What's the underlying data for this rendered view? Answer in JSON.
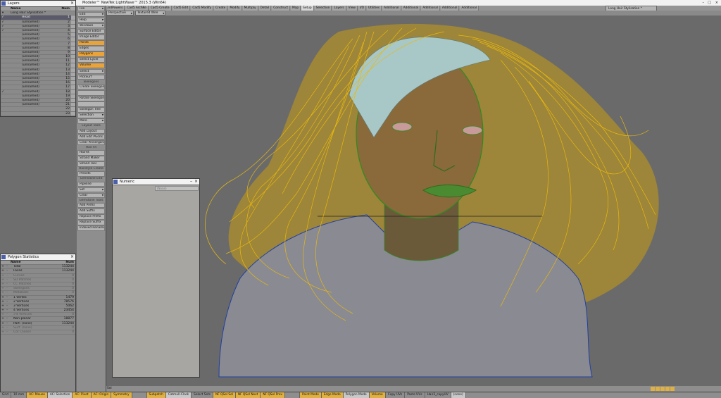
{
  "window_title": "Modeler™ NewTek LightWave™ 2015.3 (Win64)",
  "menu_button": "File",
  "tabs": [
    "3rdPowers",
    "Cad5 ArchKe",
    "Cad5 Create",
    "Cad5 Edit",
    "Cad5 Modify",
    "Create",
    "Modify",
    "Multiply",
    "Detail",
    "Construct",
    "Map",
    "Setup",
    "Selection",
    "Layers",
    "View",
    "I/O",
    "Utilities",
    "Additional",
    "Additional",
    "Additional",
    "Additional",
    "Additional"
  ],
  "active_tab": "Setup",
  "scene_label": "Long Hair Stylisation *",
  "viewport": {
    "projection": "Perspective",
    "render_mode": "Textured Wire"
  },
  "toolbox": [
    {
      "label": "File",
      "dd": true
    },
    {
      "label": "Edit",
      "dd": true
    },
    {
      "label": "Help",
      "dd": true
    },
    {
      "label": "Windows",
      "dd": true
    },
    {
      "label": "Surface Editor"
    },
    {
      "label": "Image Editor"
    },
    {
      "label": "Points",
      "on": true
    },
    {
      "label": "Edges"
    },
    {
      "label": "Polygons",
      "on": true
    },
    {
      "label": "Select Cycle"
    },
    {
      "label": "Volume",
      "on": true
    },
    {
      "label": "Select",
      "dd": true
    },
    {
      "label": "PickSurf"
    },
    {
      "head": "Skelegons"
    },
    {
      "label": "Create Skelegons"
    },
    {
      "label": ""
    },
    {
      "label": "Rotate Skelegons"
    },
    {
      "label": ""
    },
    {
      "label": "Skelegon Tree"
    },
    {
      "label": "Selection",
      "dd": true
    },
    {
      "label": "More",
      "dd": true
    },
    {
      "head": "Layout Tools"
    },
    {
      "label": "Add Layout"
    },
    {
      "label": "Add Edit PGons"
    },
    {
      "label": "Clear Pinnergons"
    },
    {
      "head": "Hair Fit"
    },
    {
      "label": "HairFit"
    },
    {
      "label": "Strand Maker"
    },
    {
      "label": "Strand Tool"
    },
    {
      "head": "Hairstyle Create"
    },
    {
      "label": "Presets"
    },
    {
      "head": "Gemstone Edit"
    },
    {
      "label": "Pipeline"
    },
    {
      "label": "Set",
      "dd": true
    },
    {
      "label": "Clear",
      "dd": true
    },
    {
      "head": "Gemstone Tools"
    },
    {
      "label": "Add Prefix"
    },
    {
      "label": "Add Suffix"
    },
    {
      "label": "Replace Prefix"
    },
    {
      "label": "Replace Suffix"
    },
    {
      "label": "Indexed Rename"
    }
  ],
  "layers_panel": {
    "title": "Layers",
    "header": {
      "name": "Name",
      "num": "Num"
    },
    "root": "Long Hair Stylisation *",
    "rows": [
      {
        "name": "Head",
        "num": "1",
        "sel": true
      },
      {
        "name": "(unnamed)",
        "num": "2"
      },
      {
        "name": "(unnamed)",
        "num": "3"
      },
      {
        "name": "(unnamed)",
        "num": "4"
      },
      {
        "name": "(unnamed)",
        "num": "5"
      },
      {
        "name": "(unnamed)",
        "num": "6"
      },
      {
        "name": "(unnamed)",
        "num": "7"
      },
      {
        "name": "(unnamed)",
        "num": "8"
      },
      {
        "name": "(unnamed)",
        "num": "9"
      },
      {
        "name": "(unnamed)",
        "num": "10"
      },
      {
        "name": "(unnamed)",
        "num": "11"
      },
      {
        "name": "(unnamed)",
        "num": "12"
      },
      {
        "name": "(unnamed)",
        "num": "13"
      },
      {
        "name": "(unnamed)",
        "num": "14"
      },
      {
        "name": "(unnamed)",
        "num": "15"
      },
      {
        "name": "(unnamed)",
        "num": "16"
      },
      {
        "name": "(unnamed)",
        "num": "17"
      },
      {
        "name": "(unnamed)",
        "num": "18"
      },
      {
        "name": "(unnamed)",
        "num": "19"
      },
      {
        "name": "(unnamed)",
        "num": "20"
      },
      {
        "name": "(unnamed)",
        "num": "21"
      },
      {
        "name": "",
        "num": "22"
      },
      {
        "name": "",
        "num": "23"
      }
    ]
  },
  "polygon_statistics": {
    "title": "Polygon Statistics",
    "header": {
      "name": "Name",
      "num": "Num"
    },
    "rows": [
      {
        "name": "Total",
        "num": "113244"
      },
      {
        "name": "Faces",
        "num": "113244"
      },
      {
        "name": "Curves",
        "num": "0",
        "dim": true
      },
      {
        "name": "SD Patches",
        "num": "0",
        "dim": true
      },
      {
        "name": "CC Patches",
        "num": "0",
        "dim": true
      },
      {
        "name": "Skelegons",
        "num": "0",
        "dim": true
      },
      {
        "name": "Metaballs",
        "num": "0",
        "dim": true
      },
      {
        "name": "1 Vertex",
        "num": "1479"
      },
      {
        "name": "2 Vertices",
        "num": "78576"
      },
      {
        "name": "3 Vertices",
        "num": "5062"
      },
      {
        "name": "4 Vertices",
        "num": "23454"
      },
      {
        "name": ">4 Vertices",
        "num": "0",
        "dim": true
      },
      {
        "name": "Non-planar",
        "num": "18877"
      },
      {
        "name": "Part: (none)",
        "num": "113244"
      },
      {
        "name": "Surf: (none)",
        "num": "0",
        "dim": true
      },
      {
        "name": "Col: (none)",
        "num": "0",
        "dim": true
      }
    ]
  },
  "numeric_panel": {
    "title": "Numeric",
    "field": "(None)"
  },
  "bottom_field": "Sel",
  "status": [
    {
      "t": "Grid",
      "c": ""
    },
    {
      "t": "10 mm",
      "c": ""
    },
    {
      "t": "AC: Mouse",
      "c": "hl"
    },
    {
      "t": "AC: Selection",
      "c": "lt"
    },
    {
      "t": "AC: Pivot",
      "c": "hl"
    },
    {
      "t": "AC: Origin",
      "c": "hl"
    },
    {
      "t": "Symmetry",
      "c": "hl"
    },
    {
      "t": "",
      "c": ""
    },
    {
      "t": "Subpatch",
      "c": "hl"
    },
    {
      "t": "Catmull-Clark",
      "c": "lt"
    },
    {
      "t": "Select Sets",
      "c": ""
    },
    {
      "t": "NF QSel Sel",
      "c": "hl"
    },
    {
      "t": "NF QSel Next",
      "c": "hl"
    },
    {
      "t": "NF QSel Prev",
      "c": "hl"
    },
    {
      "t": "",
      "c": ""
    },
    {
      "t": "Point Mode",
      "c": "hl"
    },
    {
      "t": "Edge Mode",
      "c": "hl"
    },
    {
      "t": "Polygon Mode",
      "c": "lt"
    },
    {
      "t": "Volume",
      "c": "hl"
    },
    {
      "t": "Copy UVs",
      "c": ""
    },
    {
      "t": "Paste UVs",
      "c": ""
    },
    {
      "t": "Hair3_copyUV",
      "c": ""
    },
    {
      "t": "(none)",
      "c": "lt"
    }
  ],
  "colors": {
    "hair": "#e8b90f",
    "mesh_skin": "#2f8a20",
    "mesh_shirt": "#2040a0",
    "background": "#6a6a6a",
    "accent": "#e8a33a"
  }
}
